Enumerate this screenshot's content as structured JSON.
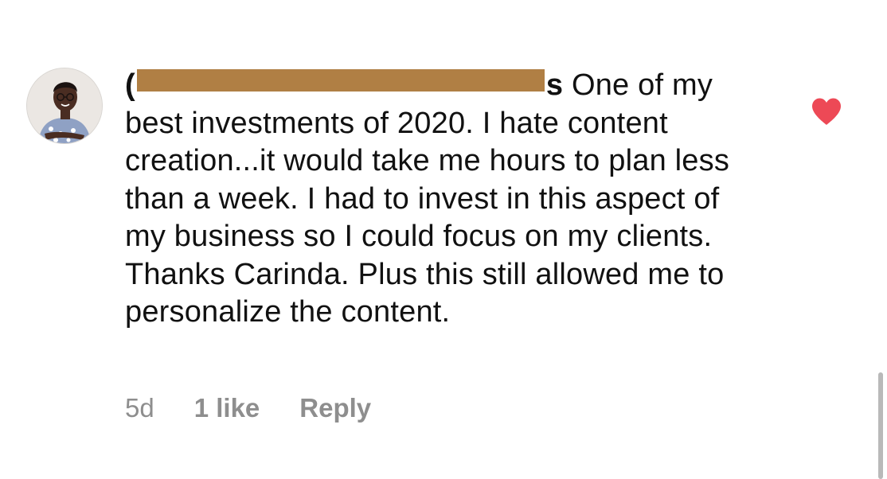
{
  "comment": {
    "username_start": "(",
    "username_end": "s",
    "text": " One of my best investments of 2020. I hate content creation...it would take me hours to plan less than a week. I had to invest in this aspect of my business so I could focus on my clients. Thanks Carinda. Plus this still allowed me to personalize the content.",
    "redaction_color": "#b07f44",
    "liked": true,
    "like_color": "#ed4956"
  },
  "meta": {
    "age": "5d",
    "likes": "1 like",
    "reply": "Reply"
  },
  "icons": {
    "like": "heart-icon",
    "avatar": "user-avatar"
  }
}
